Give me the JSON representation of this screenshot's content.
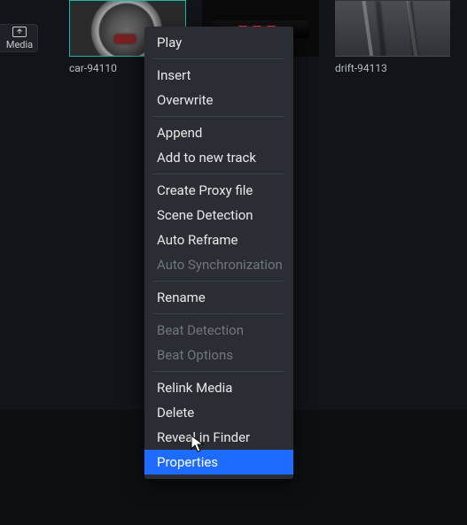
{
  "sidebar": {
    "media_label": "Media"
  },
  "thumbnails": [
    {
      "label": "car-94110",
      "selected": true
    },
    {
      "label": ""
    },
    {
      "label": "drift-94113"
    }
  ],
  "context_menu": {
    "groups": [
      [
        {
          "label": "Play",
          "enabled": true
        }
      ],
      [
        {
          "label": "Insert",
          "enabled": true
        },
        {
          "label": "Overwrite",
          "enabled": true
        }
      ],
      [
        {
          "label": "Append",
          "enabled": true
        },
        {
          "label": "Add to new track",
          "enabled": true
        }
      ],
      [
        {
          "label": "Create Proxy file",
          "enabled": true
        },
        {
          "label": "Scene Detection",
          "enabled": true
        },
        {
          "label": "Auto Reframe",
          "enabled": true
        },
        {
          "label": "Auto Synchronization",
          "enabled": false
        }
      ],
      [
        {
          "label": "Rename",
          "enabled": true
        }
      ],
      [
        {
          "label": "Beat Detection",
          "enabled": false
        },
        {
          "label": "Beat Options",
          "enabled": false
        }
      ],
      [
        {
          "label": "Relink Media",
          "enabled": true
        },
        {
          "label": "Delete",
          "enabled": true
        },
        {
          "label": "Reveal in Finder",
          "enabled": true
        },
        {
          "label": "Properties",
          "enabled": true,
          "highlighted": true
        }
      ]
    ]
  }
}
